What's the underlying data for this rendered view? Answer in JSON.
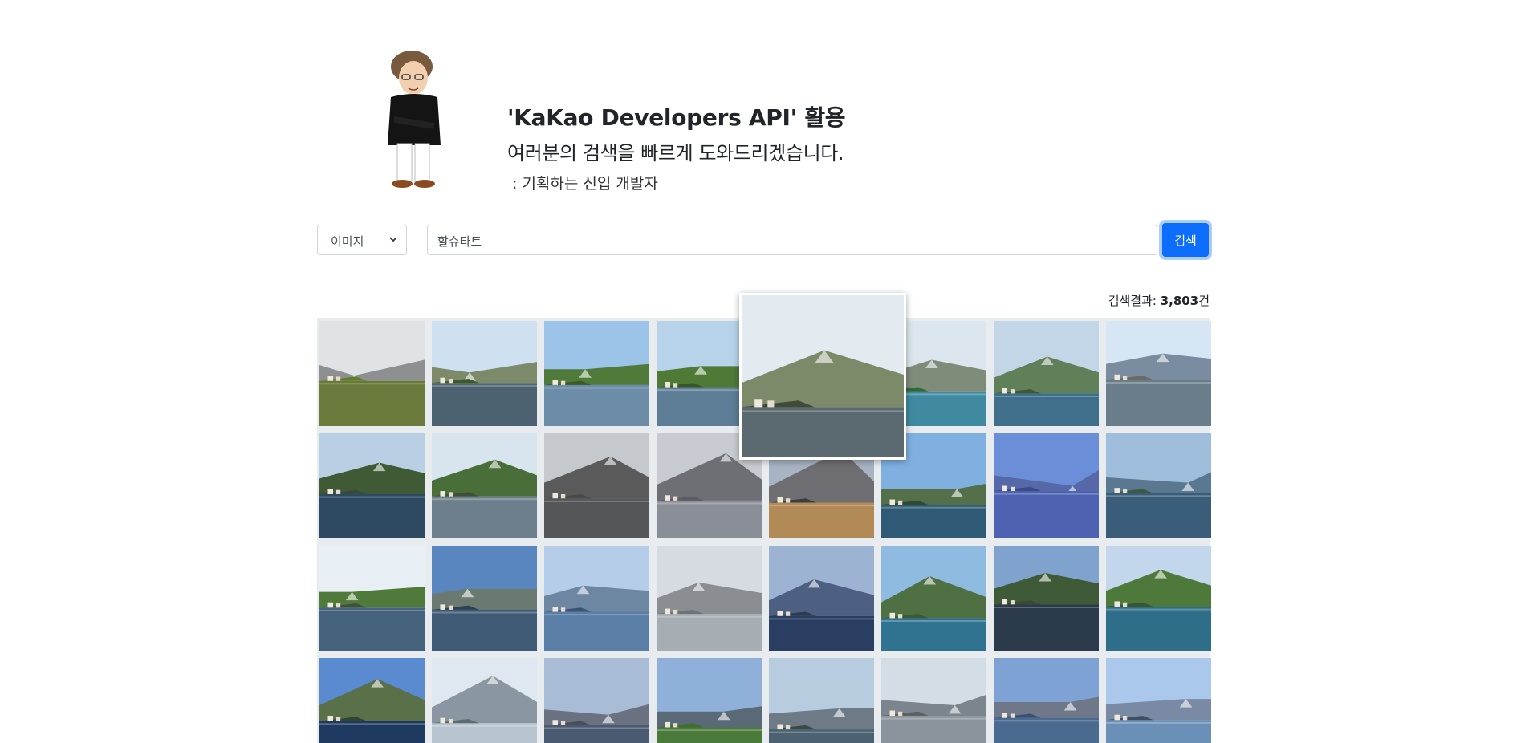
{
  "header": {
    "title": "'KaKao Developers API' 활용",
    "subtitle": "여러분의 검색을 빠르게 도와드리겠습니다.",
    "author": ": 기획하는 신입 개발자"
  },
  "search": {
    "type_selected": "이미지",
    "query": "할슈타트",
    "button_label": "검색"
  },
  "results": {
    "count_label": "검색결과: ",
    "count_value": "3,803",
    "count_unit": "건"
  },
  "colors": {
    "primary": "#0d6efd",
    "grid_bg": "#e9ecef"
  },
  "thumbnails": [
    {
      "sky": "#dfe3e6",
      "mount": "#8d8f91",
      "water": "#6a7a3a",
      "ground": "#5f7d2a"
    },
    {
      "sky": "#cfe0f0",
      "mount": "#7d8a6a",
      "water": "#4d6270",
      "ground": "#3f5a2a"
    },
    {
      "sky": "#9cc3e8",
      "mount": "#4f7a3a",
      "water": "#6d8ca8",
      "ground": "#3a5a28"
    },
    {
      "sky": "#b7d3ea",
      "mount": "#4e7a36",
      "water": "#5d7e96",
      "ground": "#39562a"
    },
    {
      "sky": "#c8d9e6",
      "mount": "#717f6a",
      "water": "#4b6675",
      "ground": "#3b3f3a"
    },
    {
      "sky": "#dbe6ee",
      "mount": "#7f8c7a",
      "water": "#3f8aa1",
      "ground": "#2f6a3a"
    },
    {
      "sky": "#c3d6e8",
      "mount": "#60805a",
      "water": "#3f6f8a",
      "ground": "#40583a"
    },
    {
      "sky": "#d6e6f4",
      "mount": "#7a8da0",
      "water": "#6a7d8a",
      "ground": "#6b6b66"
    },
    {
      "sky": "#b9cfe3",
      "mount": "#3f5a35",
      "water": "#2e4a63",
      "ground": "#3a4a3a"
    },
    {
      "sky": "#d8e4ee",
      "mount": "#4a6e3a",
      "water": "#6d7f8c",
      "ground": "#3f4f35"
    },
    {
      "sky": "#c5c9cd",
      "mount": "#5a5a5a",
      "water": "#545658",
      "ground": "#4a4a4a"
    },
    {
      "sky": "#c8ccd2",
      "mount": "#6d6f75",
      "water": "#8a8e96",
      "ground": "#5a5c62"
    },
    {
      "sky": "#a8b4c4",
      "mount": "#6e6e72",
      "water": "#b28a58",
      "ground": "#3a3c40"
    },
    {
      "sky": "#7fb0e0",
      "mount": "#53704a",
      "water": "#2f5a75",
      "ground": "#2f4a32"
    },
    {
      "sky": "#6a8fd8",
      "mount": "#5668a8",
      "water": "#4d62b0",
      "ground": "#3a4a88"
    },
    {
      "sky": "#9fbedc",
      "mount": "#5a7890",
      "water": "#3a5e7a",
      "ground": "#3d5a48"
    },
    {
      "sky": "#e8f0f6",
      "mount": "#4f7a3a",
      "water": "#45637c",
      "ground": "#40503a"
    },
    {
      "sky": "#5a86c0",
      "mount": "#6b7a70",
      "water": "#3f5a74",
      "ground": "#2e4052"
    },
    {
      "sky": "#b5cde8",
      "mount": "#6d86a2",
      "water": "#5a7ea6",
      "ground": "#3c5272"
    },
    {
      "sky": "#d5dbe0",
      "mount": "#8a8e92",
      "water": "#a6adb3",
      "ground": "#6d7379"
    },
    {
      "sky": "#9cb4d2",
      "mount": "#4e6082",
      "water": "#2a3e62",
      "ground": "#2a3a52"
    },
    {
      "sky": "#8fbbe0",
      "mount": "#4f7042",
      "water": "#2f7390",
      "ground": "#3a5a3a"
    },
    {
      "sky": "#7fa3cc",
      "mount": "#3f5a36",
      "water": "#2a3a4a",
      "ground": "#3a4a32"
    },
    {
      "sky": "#c2d6ec",
      "mount": "#4d7a3a",
      "water": "#2f6e88",
      "ground": "#3a5530"
    },
    {
      "sky": "#5a8ad0",
      "mount": "#5a7048",
      "water": "#1f3a60",
      "ground": "#2e4630"
    },
    {
      "sky": "#dfe8f0",
      "mount": "#8a96a2",
      "water": "#b8c4d0",
      "ground": "#5c6a72"
    },
    {
      "sky": "#a8bcd6",
      "mount": "#6a7282",
      "water": "#4a5a70",
      "ground": "#4a4e58"
    },
    {
      "sky": "#8fb0d8",
      "mount": "#5a6a78",
      "water": "#4a7a3a",
      "ground": "#3f6e2e"
    },
    {
      "sky": "#b8cce0",
      "mount": "#6e7a86",
      "water": "#4c6272",
      "ground": "#3a4a42"
    },
    {
      "sky": "#d3dde6",
      "mount": "#7c858e",
      "water": "#8a949c",
      "ground": "#5a6268"
    },
    {
      "sky": "#7ea2d4",
      "mount": "#6e7888",
      "water": "#4a6a90",
      "ground": "#3c5170"
    },
    {
      "sky": "#a9c8ec",
      "mount": "#7a8aa4",
      "water": "#6a90b8",
      "ground": "#3f4e62"
    }
  ],
  "preview": {
    "sky": "#e4ebf0",
    "mount": "#7d8a6a",
    "water": "#5b6a70",
    "ground": "#3f4a38"
  }
}
